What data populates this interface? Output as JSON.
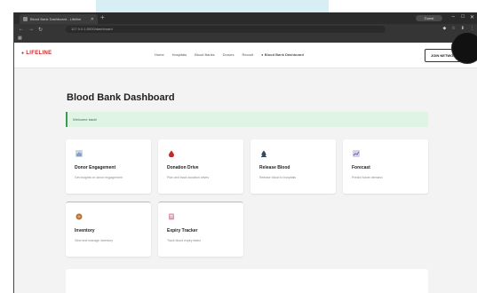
{
  "browser": {
    "tab_title": "Blood Bank Dashboard - Lifeline",
    "url": "127.0.0.1:5000/dashboard",
    "profile": "Guest"
  },
  "site": {
    "logo": "LIFELINE",
    "nav": [
      "Home",
      "Hospitals",
      "Blood Banks",
      "Donors",
      "Recruit",
      "Blood Bank Dashboard"
    ],
    "join_button": "JOIN NETWORK"
  },
  "dashboard": {
    "title": "Blood Bank Dashboard",
    "alert": "Welcome back!",
    "cards": [
      {
        "title": "Donor Engagement",
        "desc": "Get insights on donor engagement",
        "icon": "chart-icon"
      },
      {
        "title": "Donation Drive",
        "desc": "Plan and track donation drives",
        "icon": "blood-drop-icon"
      },
      {
        "title": "Release Blood",
        "desc": "Release blood to hospitals",
        "icon": "blood-bag-icon"
      },
      {
        "title": "Forecast",
        "desc": "Predict future demand",
        "icon": "forecast-icon"
      },
      {
        "title": "Inventory",
        "desc": "View and manage inventory",
        "icon": "inventory-icon"
      },
      {
        "title": "Expiry Tracker",
        "desc": "Track blood expiry dates",
        "icon": "expiry-icon"
      }
    ]
  },
  "colors": {
    "brand_red": "#c22a2a",
    "alert_green": "#dff4e4",
    "card_accent": "#e6a3b3"
  }
}
